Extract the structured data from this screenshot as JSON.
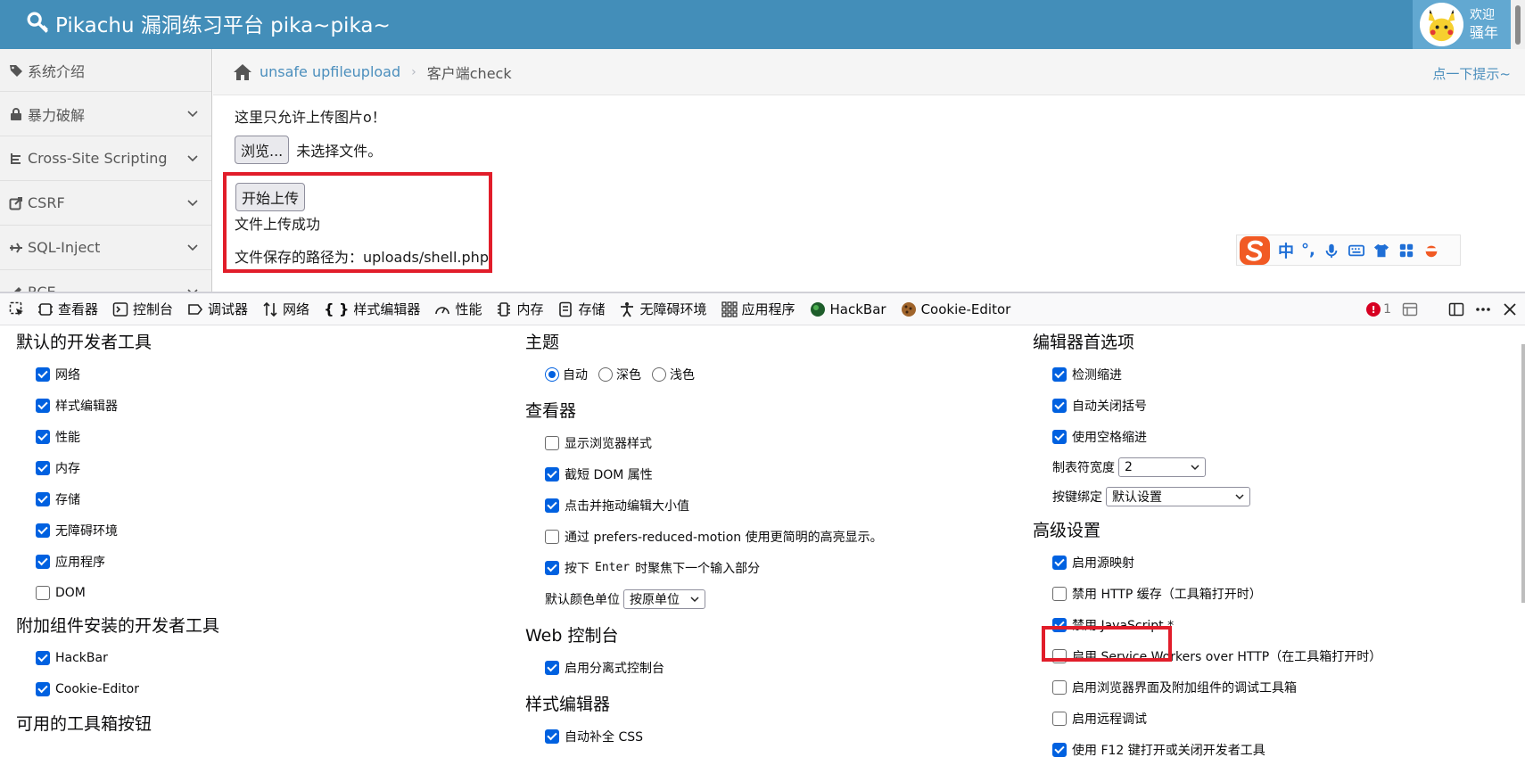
{
  "header": {
    "title": "Pikachu 漏洞练习平台 pika~pika~",
    "welcome_line1": "欢迎",
    "welcome_line2": "骚年"
  },
  "sidebar": {
    "items": [
      {
        "label": "系统介绍"
      },
      {
        "label": "暴力破解"
      },
      {
        "label": "Cross-Site Scripting"
      },
      {
        "label": "CSRF"
      },
      {
        "label": "SQL-Inject"
      },
      {
        "label": "RCE"
      }
    ]
  },
  "breadcrumb": {
    "section": "unsafe upfileupload",
    "current": "客户端check",
    "hint": "点一下提示~"
  },
  "content": {
    "notice": "这里只允许上传图片o！",
    "browse_label": "浏览...",
    "no_file": "未选择文件。",
    "upload_label": "开始上传",
    "success": "文件上传成功",
    "path": "文件保存的路径为：uploads/shell.php"
  },
  "ime": {
    "lang": "中",
    "punct": "°,"
  },
  "devtools": {
    "tabs": [
      "查看器",
      "控制台",
      "调试器",
      "网络",
      "样式编辑器",
      "性能",
      "内存",
      "存储",
      "无障碍环境",
      "应用程序",
      "HackBar",
      "Cookie-Editor"
    ],
    "error_count": "1",
    "col1": {
      "title": "默认的开发者工具",
      "items": [
        {
          "label": "网络",
          "checked": true
        },
        {
          "label": "样式编辑器",
          "checked": true
        },
        {
          "label": "性能",
          "checked": true
        },
        {
          "label": "内存",
          "checked": true
        },
        {
          "label": "存储",
          "checked": true
        },
        {
          "label": "无障碍环境",
          "checked": true
        },
        {
          "label": "应用程序",
          "checked": true
        },
        {
          "label": "DOM",
          "checked": false
        }
      ],
      "addon_title": "附加组件安装的开发者工具",
      "addon_items": [
        {
          "label": "HackBar",
          "checked": true
        },
        {
          "label": "Cookie-Editor",
          "checked": true
        }
      ],
      "toolbox_title": "可用的工具箱按钮"
    },
    "col2": {
      "theme_title": "主题",
      "theme_options": [
        "自动",
        "深色",
        "浅色"
      ],
      "inspector_title": "查看器",
      "inspector_items": [
        {
          "label": "显示浏览器样式",
          "checked": false
        },
        {
          "label": "截短 DOM 属性",
          "checked": true
        },
        {
          "label": "点击并拖动编辑大小值",
          "checked": true
        },
        {
          "label": "通过 prefers-reduced-motion 使用更简明的高亮显示。",
          "checked": false
        }
      ],
      "enter_pre": "按下",
      "enter_key": "Enter",
      "enter_post": "时聚焦下一个输入部分",
      "color_unit_label": "默认颜色单位",
      "color_unit_value": "按原单位",
      "console_title": "Web 控制台",
      "console_item": "启用分离式控制台",
      "style_title": "样式编辑器",
      "style_item": "自动补全 CSS"
    },
    "col3": {
      "editor_title": "编辑器首选项",
      "editor_items": [
        {
          "label": "检测缩进",
          "checked": true
        },
        {
          "label": "自动关闭括号",
          "checked": true
        },
        {
          "label": "使用空格缩进",
          "checked": true
        }
      ],
      "tab_width_label": "制表符宽度",
      "tab_width_value": "2",
      "keymap_label": "按键绑定",
      "keymap_value": "默认设置",
      "advanced_title": "高级设置",
      "advanced_items": [
        {
          "label": "启用源映射",
          "checked": true
        },
        {
          "label": "禁用 HTTP 缓存（工具箱打开时）",
          "checked": false
        },
        {
          "label": "禁用 JavaScript *",
          "checked": true
        },
        {
          "label": "启用 Service Workers over HTTP（在工具箱打开时）",
          "checked": false
        },
        {
          "label": "启用浏览器界面及附加组件的调试工具箱",
          "checked": false
        },
        {
          "label": "启用远程调试",
          "checked": false
        },
        {
          "label": "使用 F12 键打开或关闭开发者工具",
          "checked": true
        }
      ]
    }
  },
  "colors": {
    "header": "#438eb9",
    "accent": "#0061e0",
    "highlight": "#e11d2a"
  }
}
